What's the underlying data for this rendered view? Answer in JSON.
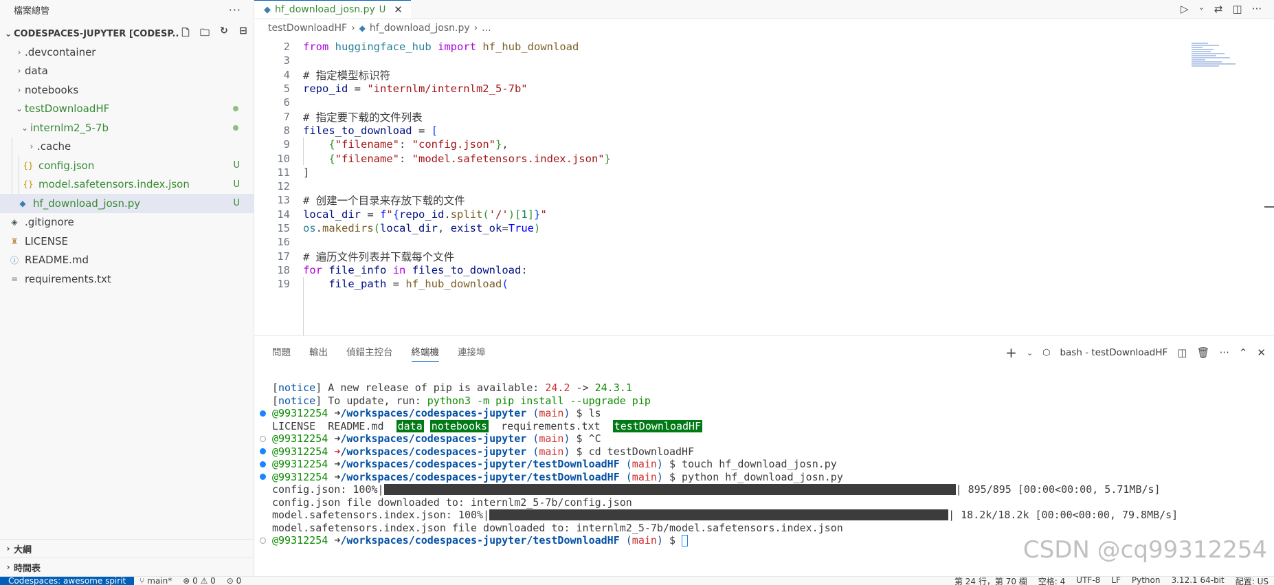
{
  "sidebar": {
    "title": "檔案總管",
    "more": "···",
    "workspace": "CODESPACES-JUPYTER [CODESP...",
    "items": [
      {
        "label": ".devcontainer",
        "type": "folder",
        "depth": 0
      },
      {
        "label": "data",
        "type": "folder",
        "depth": 0
      },
      {
        "label": "notebooks",
        "type": "folder",
        "depth": 0
      },
      {
        "label": "testDownloadHF",
        "type": "folder-open",
        "depth": 0
      },
      {
        "label": "internlm2_5-7b",
        "type": "folder-open",
        "depth": 1
      },
      {
        "label": ".cache",
        "type": "folder",
        "depth": 2
      },
      {
        "label": "config.json",
        "type": "json",
        "depth": 2,
        "badge": "U"
      },
      {
        "label": "model.safetensors.index.json",
        "type": "json",
        "depth": 2,
        "badge": "U"
      },
      {
        "label": "hf_download_josn.py",
        "type": "py",
        "depth": 1,
        "badge": "U"
      },
      {
        "label": ".gitignore",
        "type": "git",
        "depth": 0
      },
      {
        "label": "LICENSE",
        "type": "license",
        "depth": 0
      },
      {
        "label": "README.md",
        "type": "info",
        "depth": 0
      },
      {
        "label": "requirements.txt",
        "type": "txt",
        "depth": 0
      }
    ],
    "outline": "大綱",
    "timeline": "時間表"
  },
  "editor": {
    "tab": {
      "label": "hf_download_josn.py",
      "badge": "U"
    },
    "breadcrumb": [
      "testDownloadHF",
      "hf_download_josn.py",
      "..."
    ],
    "lines": [
      {
        "n": "2",
        "text": "from huggingface_hub import hf_hub_download"
      },
      {
        "n": "3",
        "text": ""
      },
      {
        "n": "4",
        "text": "# 指定模型标识符"
      },
      {
        "n": "5",
        "text": "repo_id = \"internlm/internlm2_5-7b\""
      },
      {
        "n": "6",
        "text": ""
      },
      {
        "n": "7",
        "text": "# 指定要下载的文件列表"
      },
      {
        "n": "8",
        "text": "files_to_download = ["
      },
      {
        "n": "9",
        "text": "    {\"filename\": \"config.json\"},"
      },
      {
        "n": "10",
        "text": "    {\"filename\": \"model.safetensors.index.json\"}"
      },
      {
        "n": "11",
        "text": "]"
      },
      {
        "n": "12",
        "text": ""
      },
      {
        "n": "13",
        "text": "# 创建一个目录来存放下载的文件"
      },
      {
        "n": "14",
        "text": "local_dir = f\"{repo_id.split('/')[1]}\""
      },
      {
        "n": "15",
        "text": "os.makedirs(local_dir, exist_ok=True)"
      },
      {
        "n": "16",
        "text": ""
      },
      {
        "n": "17",
        "text": "# 遍历文件列表并下载每个文件"
      },
      {
        "n": "18",
        "text": "for file_info in files_to_download:"
      },
      {
        "n": "19",
        "text": "    file_path = hf_hub_download("
      }
    ]
  },
  "panel": {
    "tabs": [
      "問題",
      "輸出",
      "偵錯主控台",
      "終端機",
      "連接埠"
    ],
    "active_tab": "終端機",
    "terminal_name": "bash - testDownloadHF",
    "terminal": {
      "notice1_tag": "notice",
      "notice1_text": " A new release of pip is available: ",
      "pip_old": "24.2",
      "pip_arrow": " -> ",
      "pip_new": "24.3.1",
      "notice2_tag": "notice",
      "notice2_text": " To update, run: ",
      "notice2_cmd": "python3 -m pip install --upgrade pip",
      "user": "@99312254",
      "arrow": "➜",
      "path_root": "/workspaces/codespaces-jupyter",
      "path_sub": "/workspaces/codespaces-jupyter/testDownloadHF",
      "branch_open": " (",
      "branch": "main",
      "branch_close": ")",
      "cmd_ls": " $ ls",
      "ls_plain1": "LICENSE  README.md  ",
      "ls_dir1": "data",
      "ls_dir2": "notebooks",
      "ls_plain2": "  requirements.txt  ",
      "ls_dir3": "testDownloadHF",
      "cmd_ctrlc": " $ ^C",
      "cmd_cd": " $ cd testDownloadHF",
      "cmd_touch": " $ touch hf_download_josn.py",
      "cmd_python": " $ python hf_download_josn.py",
      "prog1_label": "config.json: 100%|",
      "prog1_stats": "| 895/895 [00:00<00:00, 5.71MB/s]",
      "prog1_done": "config.json file downloaded to: internlm2_5-7b/config.json",
      "prog2_label": "model.safetensors.index.json: 100%|",
      "prog2_stats": "| 18.2k/18.2k [00:00<00:00, 79.8MB/s]",
      "prog2_done": "model.safetensors.index.json file downloaded to: internlm2_5-7b/model.safetensors.index.json",
      "prompt_end": " $ "
    }
  },
  "watermark": "CSDN @cq99312254",
  "statusbar": {
    "remote": "Codespaces: awesome spirit",
    "branch": "main*",
    "problems": "⊗ 0 ⚠ 0",
    "ports": "0",
    "position": "第 24 行，第 70 欄",
    "spaces": "空格: 4",
    "encoding": "UTF-8",
    "eol": "LF",
    "language": "Python",
    "interpreter": "3.12.1 64-bit",
    "layout": "配置: US"
  },
  "colors": {
    "accent": "#005fb8",
    "untracked": "#388a34",
    "selection": "#e4e6f1"
  }
}
